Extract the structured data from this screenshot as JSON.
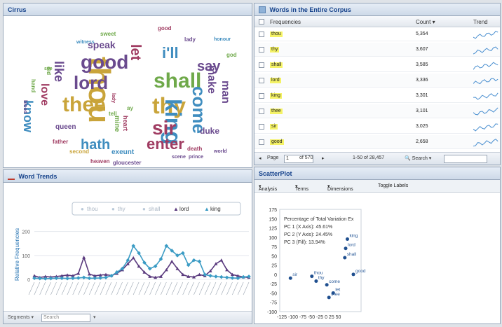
{
  "cirrus": {
    "title": "Cirrus",
    "words": [
      {
        "t": "thou",
        "c": "#c9a43a",
        "s": 44,
        "x": 158,
        "y": 58,
        "r": 90
      },
      {
        "t": "good",
        "c": "#6a4a8e",
        "s": 28,
        "x": 110,
        "y": 52,
        "r": 0
      },
      {
        "t": "shall",
        "c": "#6fa94a",
        "s": 30,
        "x": 214,
        "y": 78,
        "r": 0
      },
      {
        "t": "lord",
        "c": "#6a4a8e",
        "s": 26,
        "x": 100,
        "y": 82,
        "r": 0
      },
      {
        "t": "thee",
        "c": "#c9a43a",
        "s": 30,
        "x": 84,
        "y": 112,
        "r": 0
      },
      {
        "t": "thy",
        "c": "#c9a43a",
        "s": 32,
        "x": 212,
        "y": 112,
        "r": 0
      },
      {
        "t": "king",
        "c": "#3f8dbf",
        "s": 32,
        "x": 258,
        "y": 118,
        "r": 90
      },
      {
        "t": "sir",
        "c": "#a03c62",
        "s": 28,
        "x": 212,
        "y": 146,
        "r": 0
      },
      {
        "t": "come",
        "c": "#3f8dbf",
        "s": 26,
        "x": 292,
        "y": 100,
        "r": 90
      },
      {
        "t": "hath",
        "c": "#3f8dbf",
        "s": 20,
        "x": 110,
        "y": 174,
        "r": 0
      },
      {
        "t": "enter",
        "c": "#a03c62",
        "s": 22,
        "x": 204,
        "y": 172,
        "r": 0
      },
      {
        "t": "i'll",
        "c": "#3f8dbf",
        "s": 22,
        "x": 226,
        "y": 42,
        "r": 0
      },
      {
        "t": "let",
        "c": "#a03c62",
        "s": 20,
        "x": 198,
        "y": 40,
        "r": 90
      },
      {
        "t": "say",
        "c": "#6a4a8e",
        "s": 20,
        "x": 276,
        "y": 62,
        "r": 0
      },
      {
        "t": "speak",
        "c": "#6a4a8e",
        "s": 14,
        "x": 120,
        "y": 34,
        "r": 0
      },
      {
        "t": "like",
        "c": "#6a4a8e",
        "s": 18,
        "x": 88,
        "y": 64,
        "r": 90
      },
      {
        "t": "know",
        "c": "#3f8dbf",
        "s": 18,
        "x": 44,
        "y": 120,
        "r": 90
      },
      {
        "t": "love",
        "c": "#a03c62",
        "s": 16,
        "x": 66,
        "y": 96,
        "r": 90
      },
      {
        "t": "make",
        "c": "#6a4a8e",
        "s": 16,
        "x": 304,
        "y": 70,
        "r": 90
      },
      {
        "t": "man",
        "c": "#6a4a8e",
        "s": 16,
        "x": 324,
        "y": 92,
        "r": 90
      },
      {
        "t": "duke",
        "c": "#6a4a8e",
        "s": 12,
        "x": 280,
        "y": 158,
        "r": 0
      },
      {
        "t": "queen",
        "c": "#6a4a8e",
        "s": 10,
        "x": 74,
        "y": 154,
        "r": 0
      },
      {
        "t": "exeunt",
        "c": "#3f8dbf",
        "s": 10,
        "x": 154,
        "y": 190,
        "r": 0
      },
      {
        "t": "father",
        "c": "#a03c62",
        "s": 8,
        "x": 70,
        "y": 176,
        "r": 0
      },
      {
        "t": "death",
        "c": "#a03c62",
        "s": 8,
        "x": 262,
        "y": 186,
        "r": 0
      },
      {
        "t": "mine",
        "c": "#6fa94a",
        "s": 10,
        "x": 166,
        "y": 142,
        "r": 90
      },
      {
        "t": "heart",
        "c": "#a03c62",
        "s": 9,
        "x": 178,
        "y": 142,
        "r": 90
      },
      {
        "t": "heaven",
        "c": "#a03c62",
        "s": 8,
        "x": 124,
        "y": 204,
        "r": 0
      },
      {
        "t": "gloucester",
        "c": "#6a4a8e",
        "s": 8,
        "x": 156,
        "y": 206,
        "r": 0
      },
      {
        "t": "scene",
        "c": "#6a4a8e",
        "s": 7,
        "x": 240,
        "y": 198,
        "r": 0
      },
      {
        "t": "prince",
        "c": "#6a4a8e",
        "s": 7,
        "x": 264,
        "y": 198,
        "r": 0
      },
      {
        "t": "world",
        "c": "#6a4a8e",
        "s": 7,
        "x": 300,
        "y": 190,
        "r": 0
      },
      {
        "t": "second",
        "c": "#c9a43a",
        "s": 8,
        "x": 94,
        "y": 190,
        "r": 0
      },
      {
        "t": "good",
        "c": "#a03c62",
        "s": 8,
        "x": 220,
        "y": 14,
        "r": 0
      },
      {
        "t": "lady",
        "c": "#6a4a8e",
        "s": 8,
        "x": 258,
        "y": 30,
        "r": 0
      },
      {
        "t": "honour",
        "c": "#3f8dbf",
        "s": 7,
        "x": 300,
        "y": 30,
        "r": 0
      },
      {
        "t": "sweet",
        "c": "#6fa94a",
        "s": 8,
        "x": 138,
        "y": 22,
        "r": 0
      },
      {
        "t": "witness",
        "c": "#3f8dbf",
        "s": 7,
        "x": 104,
        "y": 34,
        "r": 0
      },
      {
        "t": "god",
        "c": "#6fa94a",
        "s": 8,
        "x": 318,
        "y": 52,
        "r": 0
      },
      {
        "t": "tell",
        "c": "#6fa94a",
        "s": 8,
        "x": 150,
        "y": 136,
        "r": 0
      },
      {
        "t": "blood",
        "c": "#6a4a8e",
        "s": 7,
        "x": 34,
        "y": 120,
        "r": 90
      },
      {
        "t": "lady",
        "c": "#a03c62",
        "s": 7,
        "x": 160,
        "y": 110,
        "r": 90
      },
      {
        "t": "ay",
        "c": "#6fa94a",
        "s": 8,
        "x": 176,
        "y": 128,
        "r": 0
      },
      {
        "t": "did",
        "c": "#6fa94a",
        "s": 8,
        "x": 68,
        "y": 72,
        "r": 90
      },
      {
        "t": "hand",
        "c": "#6fa94a",
        "s": 8,
        "x": 46,
        "y": 90,
        "r": 90
      },
      {
        "t": "see",
        "c": "#6fa94a",
        "s": 7,
        "x": 58,
        "y": 72,
        "r": 0
      }
    ]
  },
  "corpus": {
    "title": "Words in the Entire Corpus",
    "col_frequencies": "Frequencies",
    "col_count": "Count",
    "col_trend": "Trend",
    "rows": [
      {
        "term": "thou",
        "count": "5,354"
      },
      {
        "term": "thy",
        "count": "3,607"
      },
      {
        "term": "shall",
        "count": "3,585"
      },
      {
        "term": "lord",
        "count": "3,336"
      },
      {
        "term": "king",
        "count": "3,301"
      },
      {
        "term": "thee",
        "count": "3,101"
      },
      {
        "term": "sir",
        "count": "3,025"
      },
      {
        "term": "good",
        "count": "2,658"
      }
    ],
    "pager": {
      "page_label": "Page",
      "page_value": "1",
      "of": "of 570",
      "range": "1-50 of 28,457",
      "search_label": "Search"
    }
  },
  "trends": {
    "title": "Word Trends",
    "ylabel": "Relative Frequencies",
    "legend": [
      {
        "name": "thou",
        "color": "#b8c8d8",
        "active": false
      },
      {
        "name": "thy",
        "color": "#b8c8d8",
        "active": false
      },
      {
        "name": "shall",
        "color": "#b8c8d8",
        "active": false
      },
      {
        "name": "lord",
        "color": "#5a3a7e",
        "active": true
      },
      {
        "name": "king",
        "color": "#3a9bc4",
        "active": true
      }
    ],
    "footer": {
      "segments": "Segments",
      "search": "Search"
    }
  },
  "chart_data": [
    {
      "type": "line",
      "title": "",
      "xlabel": "",
      "ylabel": "Relative Frequencies",
      "ylim": [
        0,
        240
      ],
      "yticks": [
        200,
        100,
        0
      ],
      "x": [
        1,
        2,
        3,
        4,
        5,
        6,
        7,
        8,
        9,
        10,
        11,
        12,
        13,
        14,
        15,
        16,
        17,
        18,
        19,
        20,
        21,
        22,
        23,
        24,
        25,
        26,
        27,
        28,
        29,
        30,
        31,
        32,
        33,
        34,
        35,
        36,
        37,
        38,
        39,
        40
      ],
      "series": [
        {
          "name": "lord",
          "color": "#5a3a7e",
          "values": [
            15,
            8,
            12,
            10,
            12,
            15,
            18,
            15,
            25,
            92,
            22,
            15,
            18,
            20,
            16,
            25,
            40,
            65,
            90,
            55,
            30,
            12,
            8,
            12,
            40,
            75,
            45,
            20,
            12,
            10,
            20,
            15,
            35,
            65,
            80,
            40,
            20,
            15,
            10,
            8
          ]
        },
        {
          "name": "king",
          "color": "#3a9bc4",
          "values": [
            5,
            4,
            3,
            4,
            5,
            5,
            4,
            5,
            6,
            8,
            5,
            5,
            6,
            8,
            15,
            30,
            45,
            80,
            140,
            110,
            70,
            45,
            55,
            85,
            140,
            120,
            100,
            110,
            60,
            80,
            75,
            20,
            15,
            12,
            10,
            8,
            6,
            5,
            10,
            12
          ]
        }
      ]
    },
    {
      "type": "scatter",
      "title": "",
      "xlabel": "",
      "ylabel": "",
      "ylim": [
        -100,
        175
      ],
      "yticks": [
        175,
        150,
        125,
        100,
        75,
        50,
        25,
        0,
        -25,
        -50,
        -75,
        -100
      ],
      "xtick_text": "-125 -100 -75 -50 -25 0 25 50",
      "annotation": {
        "title": "Percentage of Total Variation Ex",
        "pc1": "PC 1 (X Axis): 45.61%",
        "pc2": "PC 2 (Y Axis): 24.45%",
        "pc3": "PC 3 (Fill): 13.94%"
      },
      "points": [
        {
          "label": "king",
          "x": 28,
          "y": 95
        },
        {
          "label": "lord",
          "x": 24,
          "y": 70
        },
        {
          "label": "shall",
          "x": 22,
          "y": 45
        },
        {
          "label": "good",
          "x": 42,
          "y": 0
        },
        {
          "label": "sir",
          "x": -105,
          "y": -10
        },
        {
          "label": "thou",
          "x": -55,
          "y": -5
        },
        {
          "label": "thy",
          "x": -45,
          "y": -18
        },
        {
          "label": "come",
          "x": -20,
          "y": -28
        },
        {
          "label": "thee",
          "x": -15,
          "y": -62
        },
        {
          "label": "let",
          "x": -5,
          "y": -50
        }
      ]
    }
  ],
  "scatter": {
    "title": "ScatterPlot",
    "toolbar": {
      "analysis": "Analysis",
      "terms": "Terms",
      "dimensions": "Dimensions",
      "toggle": "Toggle Labels"
    }
  }
}
